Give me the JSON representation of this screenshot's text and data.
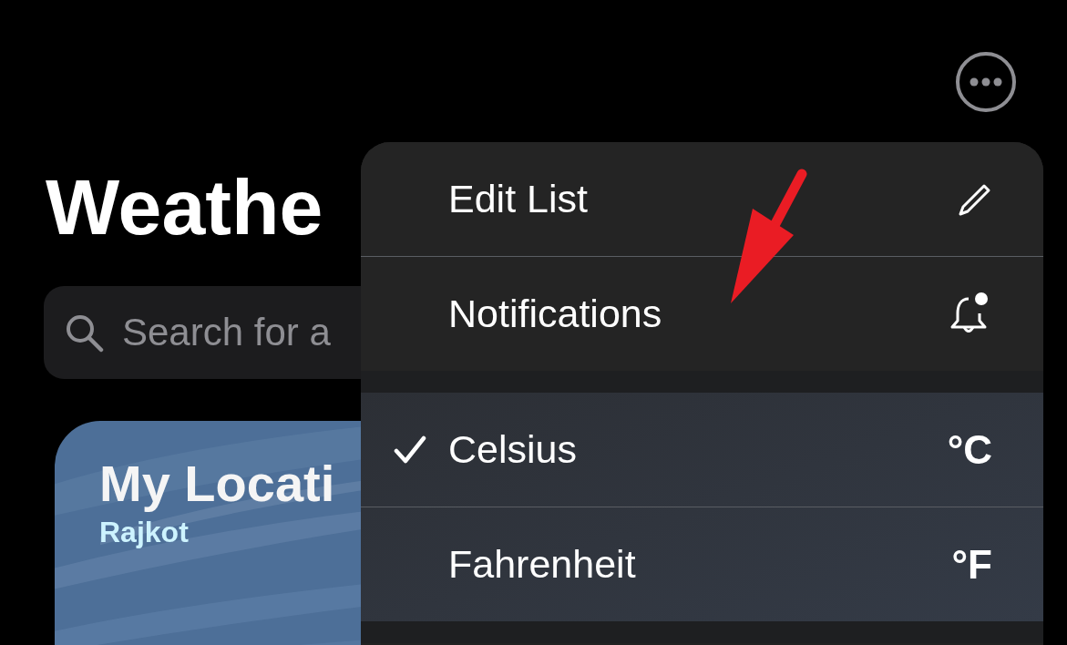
{
  "header": {
    "title": "Weathe"
  },
  "search": {
    "placeholder": "Search for a"
  },
  "location_card": {
    "kind": "picture",
    "title": "My Locati",
    "subtitle": "Rajkot"
  },
  "menu": {
    "sections": [
      {
        "items": [
          {
            "kind": "action",
            "label": "Edit List"
          },
          {
            "kind": "action",
            "label": "Notifications"
          }
        ]
      },
      {
        "items": [
          {
            "kind": "option",
            "label": "Celsius",
            "trailing": "°C",
            "selected": true
          },
          {
            "kind": "option",
            "label": "Fahrenheit",
            "trailing": "°F",
            "selected": false
          }
        ]
      }
    ]
  }
}
